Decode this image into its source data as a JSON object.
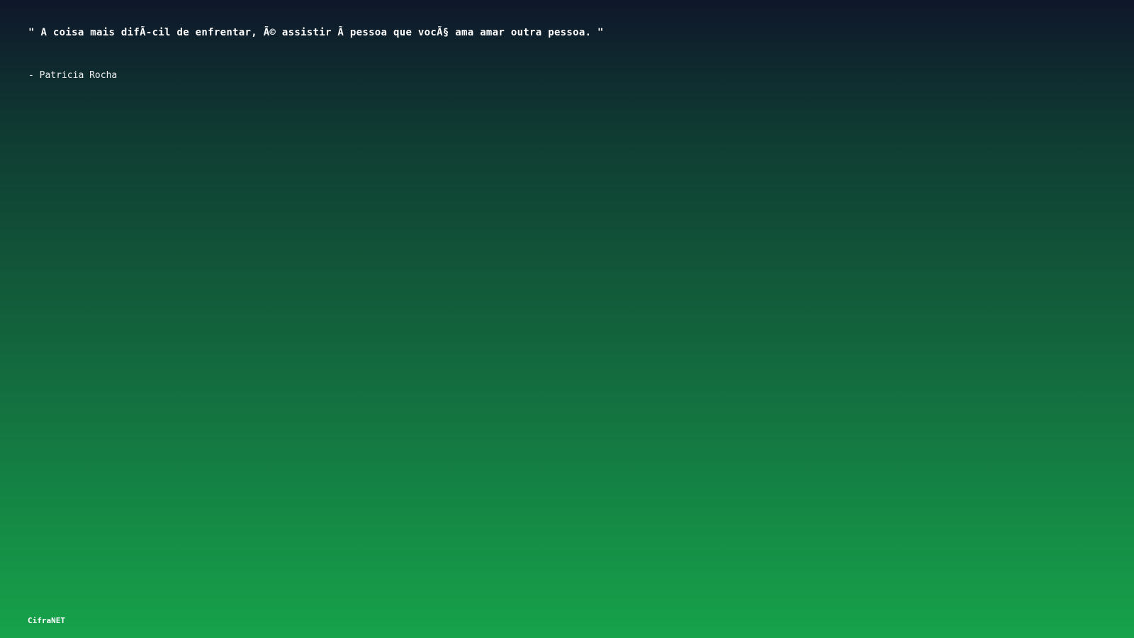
{
  "quote": {
    "text": "\" A coisa mais difÃ-cil de enfrentar, Ã© assistir Ã  pessoa que vocÃ§ ama amar outra pessoa. \"",
    "author": "- Patricia Rocha"
  },
  "footer": {
    "brand": "CifraNET"
  },
  "colors": {
    "gradient_top": "#0f172a",
    "gradient_bottom": "#16a34a",
    "text": "#ffffff"
  }
}
